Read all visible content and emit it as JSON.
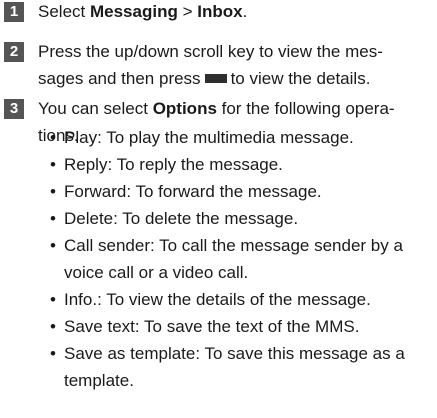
{
  "steps": [
    {
      "number": "1",
      "prefix": "Select ",
      "bold1": "Messaging",
      "sep": " > ",
      "bold2": "Inbox",
      "suffix": "."
    },
    {
      "number": "2",
      "line1": "Press the up/down scroll key to view the mes-",
      "line2_before": "sages and then press",
      "key_icon": "center-key-icon",
      "line2_after": "to view the details."
    },
    {
      "number": "3",
      "prefix": "You can select ",
      "bold": "Options",
      "line1_after": " for the following opera-",
      "line2": "tions."
    }
  ],
  "bullet_symbol": "•",
  "options": [
    {
      "text": "Play: To play the multimedia message."
    },
    {
      "text": "Reply: To reply the message."
    },
    {
      "text": "Forward: To forward the message."
    },
    {
      "text": "Delete: To delete the message."
    },
    {
      "text": "Call sender: To call the message sender by a",
      "cont": "voice call or a video call."
    },
    {
      "text": "Info.: To view the details of the message."
    },
    {
      "text": "Save text: To save the text of the MMS."
    },
    {
      "text": "Save as template: To save this message as a",
      "cont": "template."
    }
  ]
}
